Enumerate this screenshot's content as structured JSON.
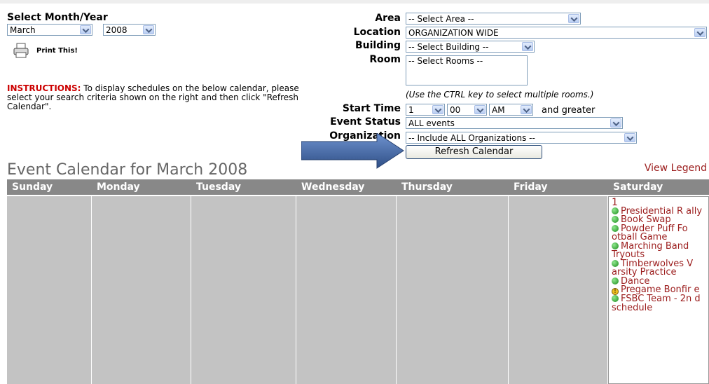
{
  "top": {
    "month_year_label": "Select Month/Year",
    "month": "March",
    "year": "2008",
    "print_label": "Print This!"
  },
  "instructions": {
    "prefix": "INSTRUCTIONS:",
    "text": "To display schedules on the below calendar, please select your search criteria shown on the right and then click \"Refresh Calendar\"."
  },
  "filters": {
    "area_label": "Area",
    "area_value": "-- Select Area --",
    "location_label": "Location",
    "location_value": "ORGANIZATION WIDE",
    "building_label": "Building",
    "building_value": "-- Select Building --",
    "room_label": "Room",
    "room_value": "-- Select Rooms --",
    "room_hint": "(Use the CTRL key to select multiple rooms.)",
    "start_time_label": "Start Time",
    "hour": "1",
    "minute": "00",
    "ampm": "AM",
    "and_greater": "and greater",
    "event_status_label": "Event Status",
    "event_status_value": "ALL events",
    "organization_label": "Organization",
    "organization_value": "-- Include ALL Organizations --",
    "refresh_label": "Refresh Calendar"
  },
  "calendar": {
    "title": "Event Calendar for March  2008",
    "legend_link": "View Legend",
    "days": [
      "Sunday",
      "Monday",
      "Tuesday",
      "Wednesday",
      "Thursday",
      "Friday",
      "Saturday"
    ],
    "saturday_date": "1",
    "events": [
      {
        "icon": "green-dot",
        "text": "Presidential R ally"
      },
      {
        "icon": "green-dot",
        "text": "Book Swap"
      },
      {
        "icon": "green-dot",
        "text": "Powder Puff Fo otball Game"
      },
      {
        "icon": "green-dot",
        "text": "Marching Band  Tryouts"
      },
      {
        "icon": "green-dot",
        "text": "Timberwolves V arsity Practice"
      },
      {
        "icon": "green-dot",
        "text": "Dance"
      },
      {
        "icon": "warning-badge",
        "text": "Pregame Bonfir e"
      },
      {
        "icon": "green-dot",
        "text": "FSBC Team - 2n d schedule"
      }
    ]
  },
  "colors": {
    "header_bg": "#888888",
    "cell_bg": "#c3c3c3",
    "event_text": "#9b1c1c",
    "instructions_accent": "#cc0000",
    "arrow": "#3a5f9a"
  }
}
